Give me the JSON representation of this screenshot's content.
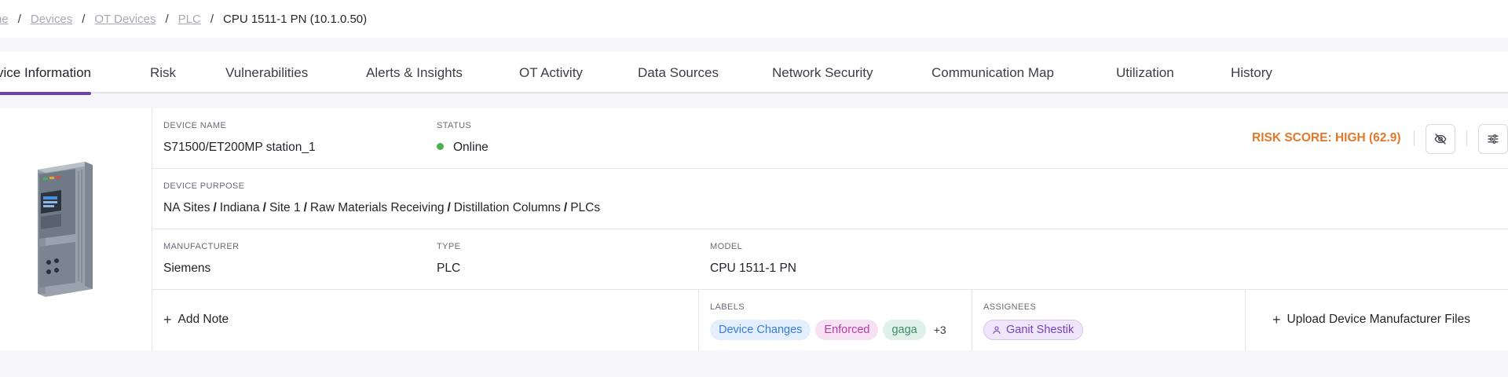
{
  "breadcrumb": {
    "items": [
      "ne",
      "Devices",
      "OT Devices",
      "PLC"
    ],
    "separator": "/",
    "current": "CPU 1511-1 PN (10.1.0.50)"
  },
  "tabs": [
    {
      "label": "vice Information",
      "active": true
    },
    {
      "label": "Risk"
    },
    {
      "label": "Vulnerabilities"
    },
    {
      "label": "Alerts & Insights"
    },
    {
      "label": "OT Activity"
    },
    {
      "label": "Data Sources"
    },
    {
      "label": "Network Security"
    },
    {
      "label": "Communication Map"
    },
    {
      "label": "Utilization"
    },
    {
      "label": "History"
    }
  ],
  "device": {
    "name_label": "DEVICE NAME",
    "name": "S71500/ET200MP station_1",
    "status_label": "STATUS",
    "status": "Online",
    "status_color": "#4caf50",
    "risk_label": "RISK SCORE:",
    "risk_value": "HIGH (62.9)",
    "risk_color": "#e2792a",
    "purpose_label": "DEVICE PURPOSE",
    "purpose": [
      "NA Sites",
      "Indiana",
      "Site 1",
      "Raw Materials Receiving",
      "Distillation Columns",
      "PLCs"
    ],
    "purpose_separator": "/",
    "manufacturer_label": "MANUFACTURER",
    "manufacturer": "Siemens",
    "type_label": "TYPE",
    "type": "PLC",
    "model_label": "MODEL",
    "model": "CPU 1511-1 PN"
  },
  "notes": {
    "plus": "+",
    "add_label": "Add Note"
  },
  "labels": {
    "title": "LABELS",
    "chips": [
      "Device Changes",
      "Enforced",
      "gaga"
    ],
    "more": "+3"
  },
  "assignees": {
    "title": "ASSIGNEES",
    "name": "Ganit Shestik"
  },
  "upload": {
    "plus": "+",
    "label": "Upload Device Manufacturer Files"
  },
  "icons": {
    "hide": "eye-off-icon",
    "settings": "sliders-icon"
  },
  "accent_color": "#6a3fb3"
}
